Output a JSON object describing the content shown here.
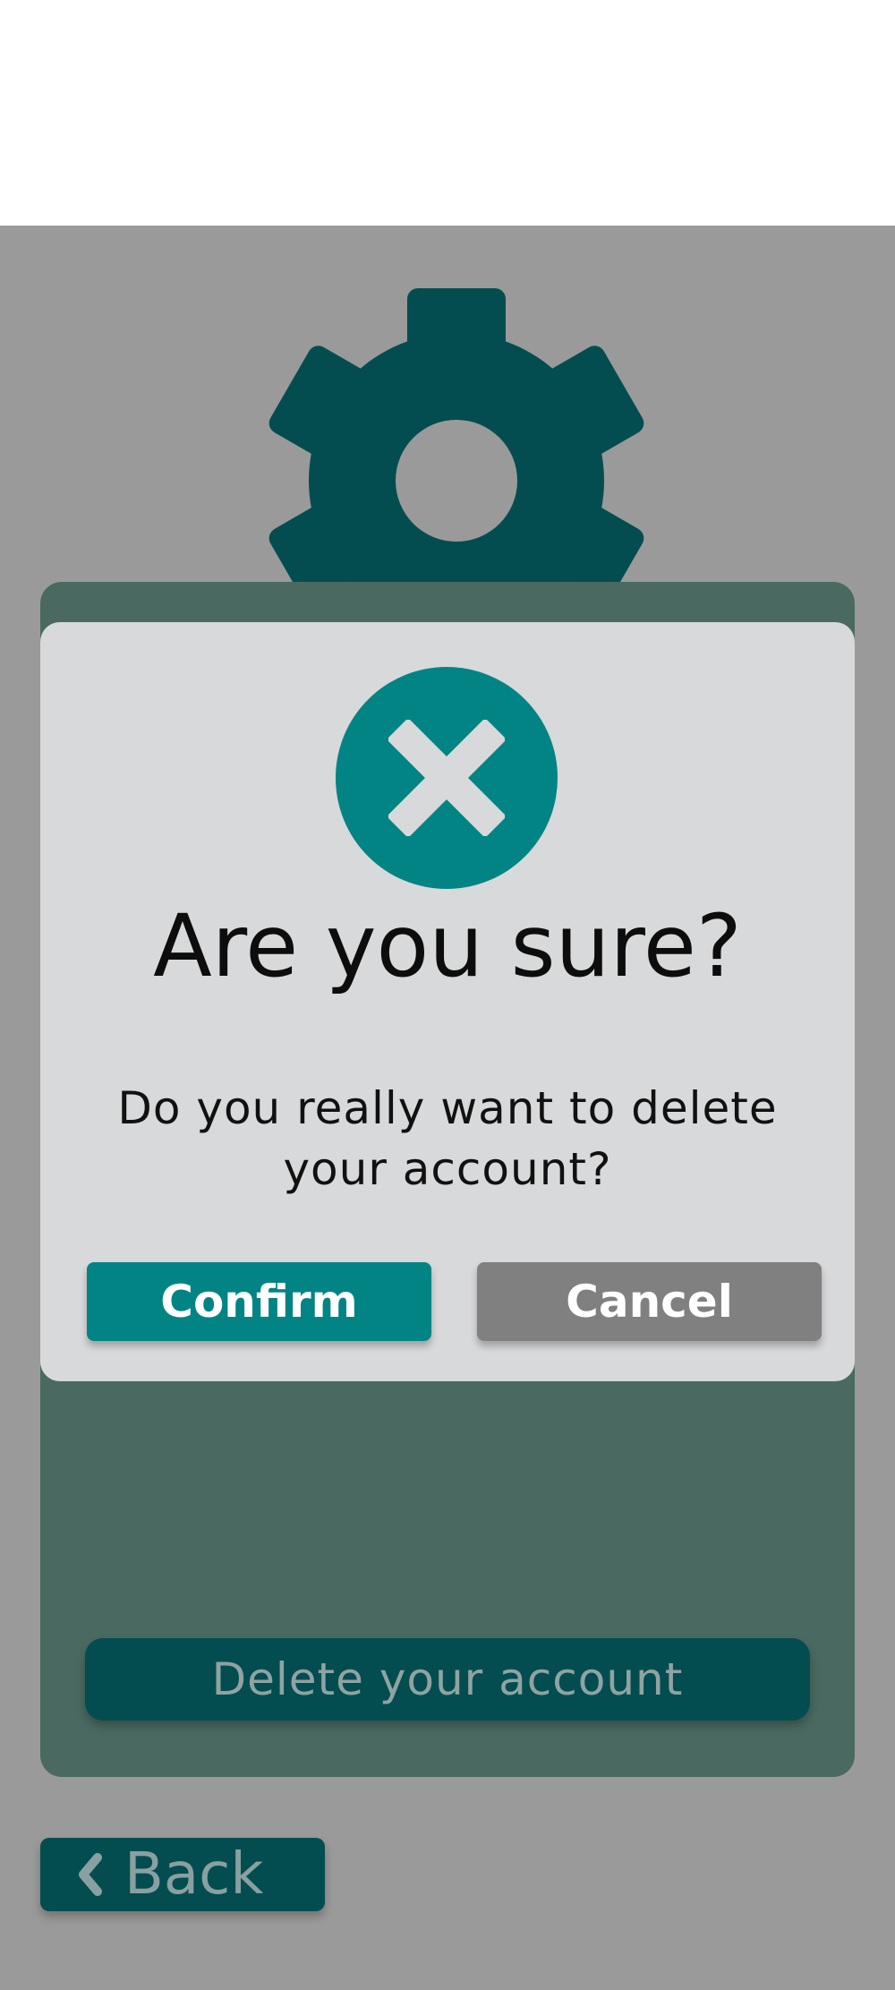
{
  "background": {
    "overlay_color": "#9a9a9a"
  },
  "settings_icon": {
    "icon": "gear-icon",
    "color": "#034d50"
  },
  "account_panel": {
    "delete_button_label": "Delete your account"
  },
  "navigation": {
    "back_label": "Back",
    "back_icon": "chevron-left-icon"
  },
  "dialog": {
    "icon": "close-circle-icon",
    "accent": "#028484",
    "title": "Are you sure?",
    "message_line1": "Do you really want to delete",
    "message_line2": "your account?",
    "confirm_label": "Confirm",
    "cancel_label": "Cancel"
  }
}
